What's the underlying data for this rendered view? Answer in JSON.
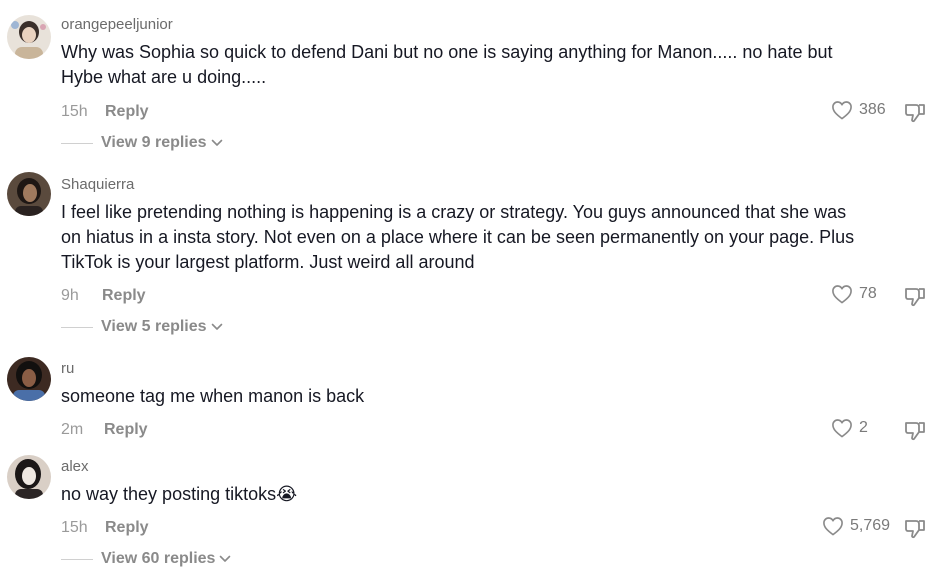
{
  "comments": [
    {
      "username": "orangepeeljunior",
      "text": "Why was Sophia so quick to defend Dani but no one is saying anything for Manon..... no hate but\nHybe what are u doing.....",
      "time": "15h",
      "reply_label": "Reply",
      "likes": "386",
      "view_replies": "View 9 replies",
      "avatar_colors": [
        "#e8e2da",
        "#3a2f2a",
        "#c9b59a"
      ]
    },
    {
      "username": "Shaquierra",
      "text": "I feel like pretending nothing is happening is a crazy or strategy. You guys announced that she was\non hiatus in a insta story. Not even on a place where it can be seen permanently on your page. Plus\nTikTok is your largest platform. Just weird all around",
      "time": "9h",
      "reply_label": "Reply",
      "likes": "78",
      "view_replies": "View 5 replies",
      "avatar_colors": [
        "#5a4a3d",
        "#1e1714",
        "#a07a5e"
      ]
    },
    {
      "username": "ru",
      "text": "someone tag me when manon is back",
      "time": "2m",
      "reply_label": "Reply",
      "likes": "2",
      "avatar_colors": [
        "#3d2a22",
        "#12100f",
        "#8a5d45"
      ]
    },
    {
      "username": "alex",
      "text": "no way they posting tiktoks",
      "emoji": "😭",
      "time": "15h",
      "reply_label": "Reply",
      "likes": "5,769",
      "view_replies": "View 60 replies",
      "avatar_colors": [
        "#d9cfc6",
        "#1b1717",
        "#efe8e2"
      ]
    }
  ],
  "icons": {
    "like": "heart-outline-icon",
    "dislike": "thumbs-down-outline-icon",
    "chevron": "chevron-down-icon"
  }
}
